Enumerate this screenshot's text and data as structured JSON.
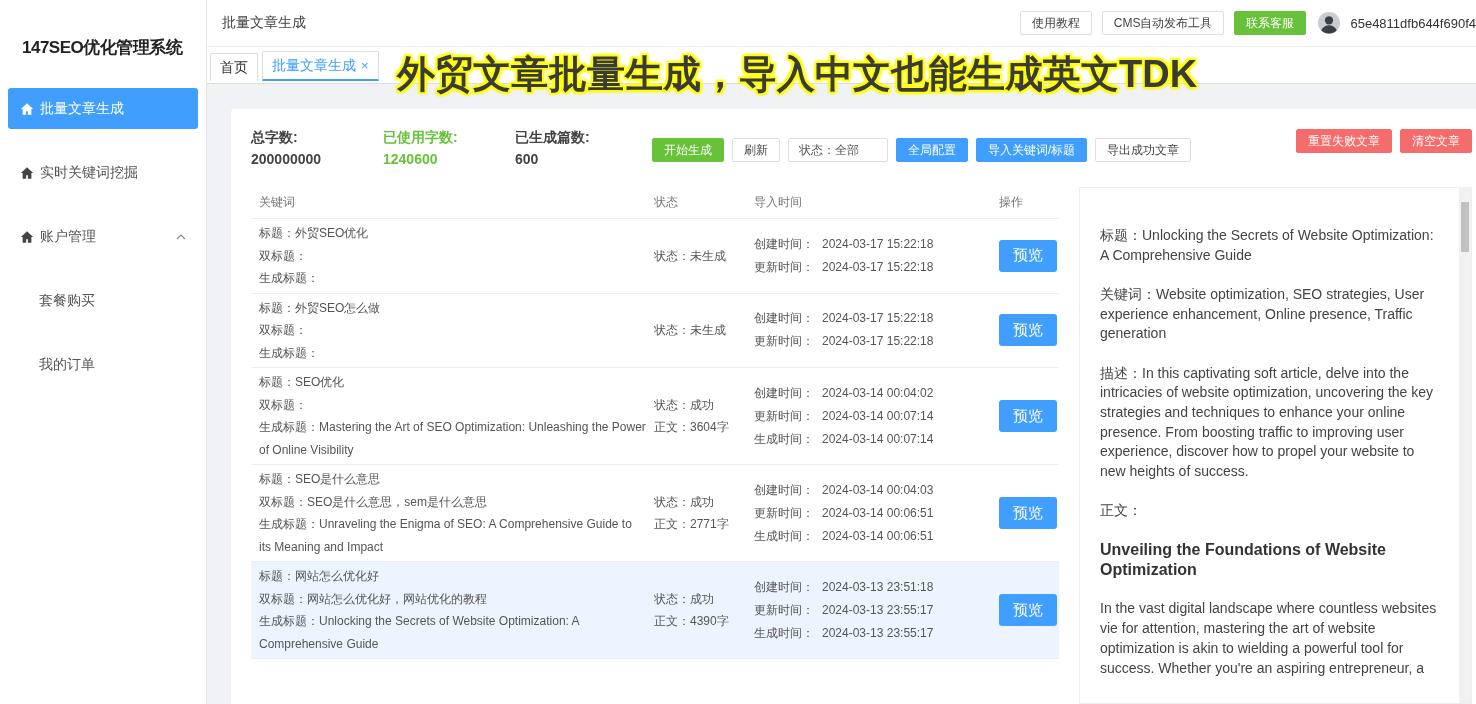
{
  "app": {
    "logo": "147SEO优化管理系统"
  },
  "sidebar": {
    "items": [
      {
        "label": "批量文章生成",
        "selected": true
      },
      {
        "label": "实时关键词挖掘",
        "selected": false
      },
      {
        "label": "账户管理",
        "selected": false,
        "expanded": true,
        "children": [
          {
            "label": "套餐购买",
            "selected": false
          },
          {
            "label": "我的订单",
            "selected": false
          }
        ]
      }
    ]
  },
  "header": {
    "breadcrumb": "批量文章生成",
    "buttons": [
      {
        "label": "使用教程",
        "kind": "default"
      },
      {
        "label": "CMS自动发布工具",
        "kind": "default"
      },
      {
        "label": "联系客服",
        "kind": "success"
      }
    ],
    "user": "65e4811dfb644f690f4"
  },
  "tabs": [
    {
      "label": "首页",
      "selected": false
    },
    {
      "label": "批量文章生成",
      "selected": true,
      "close": "×"
    }
  ],
  "caption": "外贸文章批量生成，导入中文也能生成英文TDK",
  "stats": [
    {
      "label": "总字数:",
      "value": "200000000",
      "kind": "normal"
    },
    {
      "label": "已使用字数:",
      "value": "1240600",
      "kind": "highlight"
    },
    {
      "label": "已生成篇数:",
      "value": "600",
      "kind": "normal"
    }
  ],
  "toolbar": [
    {
      "kind": "success",
      "label": "开始生成"
    },
    {
      "kind": "default",
      "label": "刷新"
    },
    {
      "kind": "select",
      "value": "状态：全部"
    },
    {
      "kind": "primary",
      "label": "全局配置"
    },
    {
      "kind": "primary",
      "label": "导入关键词/标题"
    },
    {
      "kind": "default",
      "label": "导出成功文章"
    }
  ],
  "toolbar_right": [
    {
      "kind": "danger",
      "label": "重置失败文章"
    },
    {
      "kind": "danger",
      "label": "清空文章"
    }
  ],
  "table": {
    "columns": [
      "关键词",
      "状态",
      "导入时间",
      "操作"
    ],
    "rows": [
      {
        "selected": false,
        "keyword_lines": [
          "标题：外贸SEO优化",
          "双标题：",
          "生成标题："
        ],
        "status_lines": [
          "状态：未生成"
        ],
        "times": [
          {
            "label": "创建时间：",
            "value": "2024-03-17 15:22:18"
          },
          {
            "label": "更新时间：",
            "value": "2024-03-17 15:22:18"
          }
        ],
        "action": "预览"
      },
      {
        "selected": false,
        "keyword_lines": [
          "标题：外贸SEO怎么做",
          "双标题：",
          "生成标题："
        ],
        "status_lines": [
          "状态：未生成"
        ],
        "times": [
          {
            "label": "创建时间：",
            "value": "2024-03-17 15:22:18"
          },
          {
            "label": "更新时间：",
            "value": "2024-03-17 15:22:18"
          }
        ],
        "action": "预览"
      },
      {
        "selected": false,
        "keyword_lines": [
          "标题：SEO优化",
          "双标题：",
          "生成标题：Mastering the Art of SEO Optimization: Unleashing the Power of Online Visibility"
        ],
        "status_lines": [
          "状态：成功",
          "正文：3604字"
        ],
        "times": [
          {
            "label": "创建时间：",
            "value": "2024-03-14 00:04:02"
          },
          {
            "label": "更新时间：",
            "value": "2024-03-14 00:07:14"
          },
          {
            "label": "生成时间：",
            "value": "2024-03-14 00:07:14"
          }
        ],
        "action": "预览"
      },
      {
        "selected": false,
        "keyword_lines": [
          "标题：SEO是什么意思",
          "双标题：SEO是什么意思，sem是什么意思",
          "生成标题：Unraveling the Enigma of SEO: A Comprehensive Guide to its Meaning and Impact"
        ],
        "status_lines": [
          "状态：成功",
          "正文：2771字"
        ],
        "times": [
          {
            "label": "创建时间：",
            "value": "2024-03-14 00:04:03"
          },
          {
            "label": "更新时间：",
            "value": "2024-03-14 00:06:51"
          },
          {
            "label": "生成时间：",
            "value": "2024-03-14 00:06:51"
          }
        ],
        "action": "预览"
      },
      {
        "selected": true,
        "keyword_lines": [
          "标题：网站怎么优化好",
          "双标题：网站怎么优化好，网站优化的教程",
          "生成标题：Unlocking the Secrets of Website Optimization: A Comprehensive Guide"
        ],
        "status_lines": [
          "状态：成功",
          "正文：4390字"
        ],
        "times": [
          {
            "label": "创建时间：",
            "value": "2024-03-13 23:51:18"
          },
          {
            "label": "更新时间：",
            "value": "2024-03-13 23:55:17"
          },
          {
            "label": "生成时间：",
            "value": "2024-03-13 23:55:17"
          }
        ],
        "action": "预览"
      }
    ]
  },
  "preview": {
    "blocks": [
      {
        "kind": "para",
        "text": "标题：Unlocking the Secrets of Website Optimization: A Comprehensive Guide"
      },
      {
        "kind": "para",
        "text": "关键词：Website optimization, SEO strategies, User experience enhancement, Online presence, Traffic generation"
      },
      {
        "kind": "para",
        "text": "描述：In this captivating soft article, delve into the intricacies of website optimization, uncovering the key strategies and techniques to enhance your online presence. From boosting traffic to improving user experience, discover how to propel your website to new heights of success."
      },
      {
        "kind": "para",
        "text": "正文："
      },
      {
        "kind": "heading",
        "text": "Unveiling the Foundations of Website Optimization"
      },
      {
        "kind": "para",
        "text": "In the vast digital landscape where countless websites vie for attention, mastering the art of website optimization is akin to wielding a powerful tool for success. Whether you're an aspiring entrepreneur, a"
      }
    ]
  }
}
